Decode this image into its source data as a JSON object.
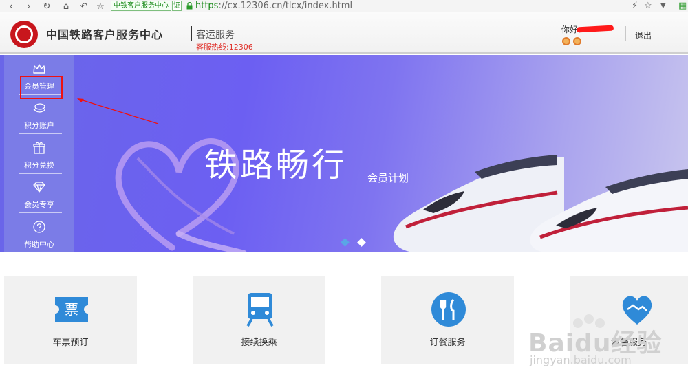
{
  "browser": {
    "site_badge": "中铁客户服务中心",
    "cert_label": "证",
    "url_scheme": "https",
    "url_rest": "://cx.12306.cn/tlcx/index.html"
  },
  "header": {
    "brand": "中国铁路客户服务中心",
    "subtitle": "客运服务",
    "hotline": "客服热线:12306",
    "greeting": "你好,",
    "logout": "退出"
  },
  "sidebar": {
    "items": [
      {
        "label": "会员管理",
        "icon": "crown-icon"
      },
      {
        "label": "积分账户",
        "icon": "coins-icon"
      },
      {
        "label": "积分兑换",
        "icon": "gift-icon"
      },
      {
        "label": "会员专享",
        "icon": "diamond-icon"
      },
      {
        "label": "帮助中心",
        "icon": "question-icon"
      }
    ]
  },
  "banner": {
    "title": "铁路畅行",
    "subtitle": "会员计划",
    "slides_total": 2,
    "active_slide": 1
  },
  "services": [
    {
      "label": "车票预订",
      "icon": "ticket-icon",
      "glyph": "票"
    },
    {
      "label": "接续换乘",
      "icon": "train-icon"
    },
    {
      "label": "订餐服务",
      "icon": "fork-knife-icon"
    },
    {
      "label": "温馨服务",
      "icon": "handshake-heart-icon"
    }
  ],
  "watermark": {
    "text": "Baidu经验",
    "url": "jingyan.baidu.com"
  },
  "colors": {
    "brand_red": "#c8161d",
    "banner_purple": "#6c5ff2",
    "highlight_red": "#ee1111",
    "service_blue": "#2f8ad8"
  }
}
